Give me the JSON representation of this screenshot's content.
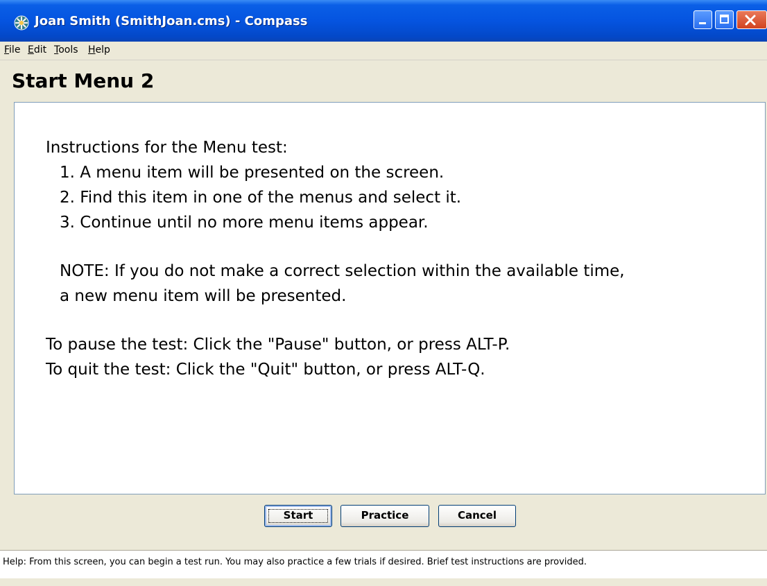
{
  "window": {
    "title": "Joan Smith (SmithJoan.cms) - Compass",
    "controls": [
      "minimize-icon",
      "maximize-icon",
      "close-icon"
    ],
    "title_bar_color": "#0554E0"
  },
  "menu": {
    "items": [
      {
        "label": "File",
        "mnemonic": "F",
        "rest": "ile"
      },
      {
        "label": "Edit",
        "mnemonic": "E",
        "rest": "dit"
      },
      {
        "label": "Tools",
        "mnemonic": "T",
        "rest": "ools"
      },
      {
        "label": "Help",
        "mnemonic": "H",
        "rest": "elp"
      }
    ]
  },
  "page": {
    "title": "Start Menu 2"
  },
  "instructions": {
    "heading": "Instructions for the Menu test:",
    "steps": [
      "1.  A menu item will be presented on the screen.",
      "2.  Find this item in one of the menus and select it.",
      "3.  Continue until no more menu items appear."
    ],
    "note_line1": "NOTE:  If you do not make a correct selection within the available time,",
    "note_line2": "a new menu item will be presented.",
    "pause": "To pause the test:  Click the \"Pause\" button, or press ALT-P.",
    "quit": "To quit the test:   Click the \"Quit\" button, or press ALT-Q."
  },
  "buttons": {
    "start": "Start",
    "practice": "Practice",
    "cancel": "Cancel"
  },
  "status": {
    "help": "Help:  From this screen, you can begin a test run.  You may also practice a few trials if desired.  Brief test instructions are provided."
  }
}
